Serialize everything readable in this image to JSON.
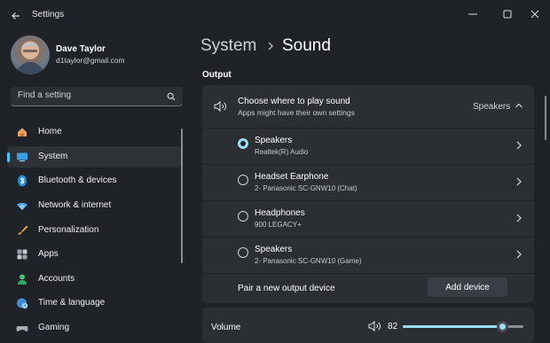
{
  "window": {
    "title": "Settings"
  },
  "user": {
    "name": "Dave Taylor",
    "email": "d1taylor@gmail.com"
  },
  "search": {
    "placeholder": "Find a setting"
  },
  "nav": {
    "items": [
      {
        "label": "Home",
        "icon": "home-icon"
      },
      {
        "label": "System",
        "icon": "monitor-icon"
      },
      {
        "label": "Bluetooth & devices",
        "icon": "bluetooth-icon"
      },
      {
        "label": "Network & internet",
        "icon": "wifi-icon"
      },
      {
        "label": "Personalization",
        "icon": "brush-icon"
      },
      {
        "label": "Apps",
        "icon": "apps-icon"
      },
      {
        "label": "Accounts",
        "icon": "person-icon"
      },
      {
        "label": "Time & language",
        "icon": "globe-clock-icon"
      },
      {
        "label": "Gaming",
        "icon": "gamepad-icon"
      }
    ],
    "active_index": 1
  },
  "breadcrumb": {
    "root": "System",
    "current": "Sound"
  },
  "output": {
    "section_label": "Output",
    "choose": {
      "title": "Choose where to play sound",
      "subtitle": "Apps might have their own settings",
      "value": "Speakers"
    },
    "devices": [
      {
        "name": "Speakers",
        "detail": "Realtek(R) Audio",
        "selected": true
      },
      {
        "name": "Headset Earphone",
        "detail": "2- Panasonic SC-GNW10 (Chat)",
        "selected": false
      },
      {
        "name": "Headphones",
        "detail": "900 LEGACY+",
        "selected": false
      },
      {
        "name": "Speakers",
        "detail": "2- Panasonic SC-GNW10 (Game)",
        "selected": false
      }
    ],
    "pair": {
      "label": "Pair a new output device",
      "button": "Add device"
    }
  },
  "volume": {
    "label": "Volume",
    "value": "82",
    "level": 82
  },
  "colors": {
    "accent": "#9bdcf2",
    "nav_indicator": "#4cc2ff",
    "background": "#1f2226",
    "card": "#2b2e33"
  }
}
